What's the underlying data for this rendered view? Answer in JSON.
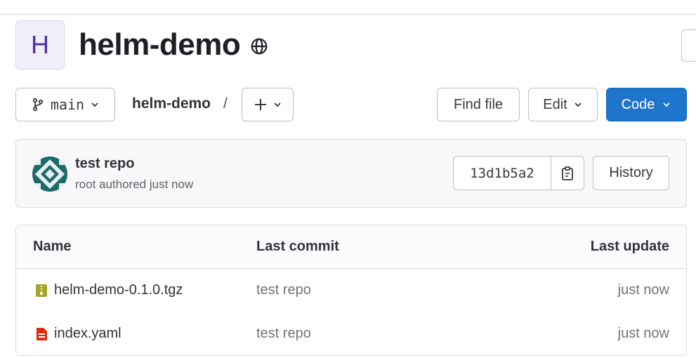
{
  "project": {
    "avatar_letter": "H",
    "title": "helm-demo",
    "visibility_icon": "globe-icon"
  },
  "toolbar": {
    "branch": "main",
    "breadcrumb_root": "helm-demo",
    "breadcrumb_separator": "/",
    "add_icon": "plus-icon",
    "find_file_label": "Find file",
    "edit_label": "Edit",
    "code_label": "Code"
  },
  "last_commit": {
    "title": "test repo",
    "meta": "root authored just now",
    "sha": "13d1b5a2",
    "copy_icon": "clipboard-icon",
    "history_label": "History"
  },
  "files": {
    "headers": {
      "name": "Name",
      "last_commit": "Last commit",
      "last_update": "Last update"
    },
    "rows": [
      {
        "name": "helm-demo-0.1.0.tgz",
        "icon": "archive-file-icon",
        "commit": "test repo",
        "updated": "just now"
      },
      {
        "name": "index.yaml",
        "icon": "yaml-file-icon",
        "commit": "test repo",
        "updated": "just now"
      }
    ]
  },
  "colors": {
    "primary": "#1f75cb",
    "avatar_bg": "#f1eefc",
    "avatar_letter": "#4e2fa0",
    "archive_icon": "#a4a62b",
    "yaml_icon": "#dd2b0e"
  }
}
